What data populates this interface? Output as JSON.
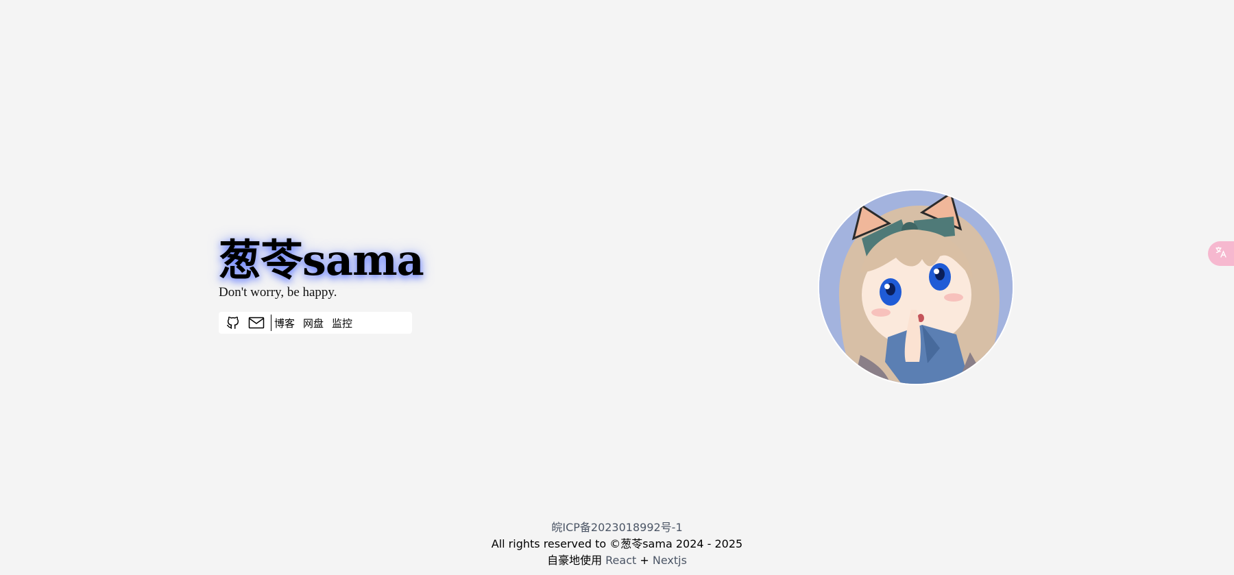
{
  "hero": {
    "title": "葱苓sama",
    "tagline": "Don't worry, be happy.",
    "icons": [
      "github-icon",
      "mail-icon"
    ],
    "links": [
      "博客",
      "网盘",
      "监控"
    ]
  },
  "translate": {
    "icon": "translate-icon",
    "accent": "#f6b8cf"
  },
  "footer": {
    "icp": "皖ICP备2023018992号-1",
    "rights": "All rights reserved to ©葱苓sama 2024 - 2025",
    "built_prefix": "自豪地使用 ",
    "react": "React",
    "plus": " + ",
    "nextjs": "Nextjs",
    "link_color": "#4b5565"
  },
  "colors": {
    "background": "#f4f4f4",
    "title_glow": "#3c5aff",
    "avatar_bg": "#a3b3de"
  }
}
